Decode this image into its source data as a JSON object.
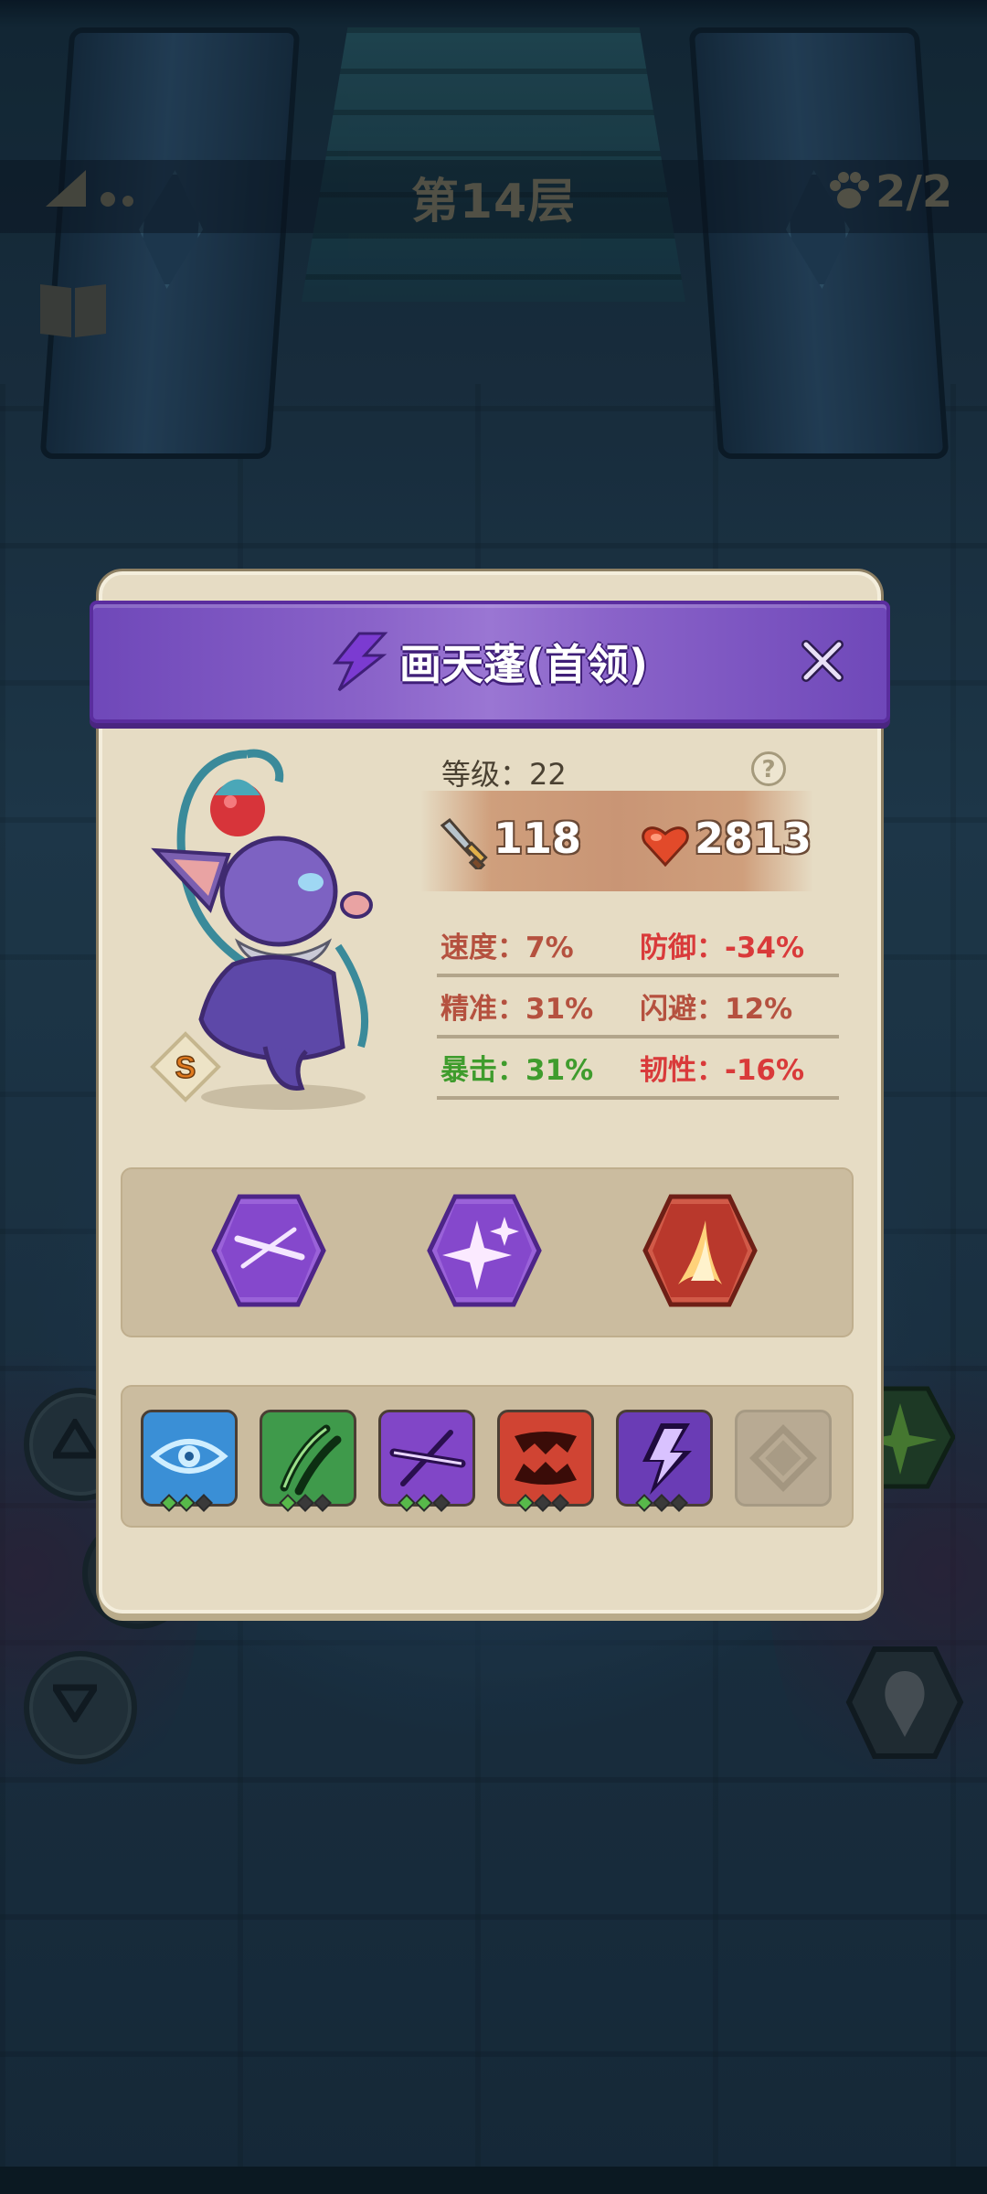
{
  "hud": {
    "floor_title": "第14层",
    "party_count": "2/2"
  },
  "panel": {
    "title": "画天蓬(首领)",
    "rank": "S",
    "level_label": "等级：22",
    "help_symbol": "?",
    "attack": "118",
    "health": "2813",
    "attributes": [
      {
        "left": "速度：7%",
        "left_color": "#b5513f",
        "right": "防御：-34%",
        "right_color": "#d93a3a"
      },
      {
        "left": "精准：31%",
        "left_color": "#b5513f",
        "right": "闪避：12%",
        "right_color": "#b5513f"
      },
      {
        "left": "暴击：31%",
        "left_color": "#3f9c2d",
        "right": "韧性：-16%",
        "right_color": "#d93a3a"
      }
    ],
    "skills": [
      {
        "icon": "slash-skill-icon",
        "color": "#8b4fd0"
      },
      {
        "icon": "sparkle-skill-icon",
        "color": "#8b4fd0"
      },
      {
        "icon": "flame-claw-skill-icon",
        "color": "#c2473a"
      }
    ],
    "equipment": [
      {
        "icon": "eye-icon",
        "color": "#3a8fd6",
        "pips": [
          "#57b94a",
          "#57b94a",
          "#3a3a3a"
        ]
      },
      {
        "icon": "claw-scratch-icon",
        "color": "#3f9a4b",
        "pips": [
          "#57b94a",
          "#3a3a3a",
          "#3a3a3a"
        ]
      },
      {
        "icon": "slash-icon",
        "color": "#8146c7",
        "pips": [
          "#57b94a",
          "#57b94a",
          "#3a3a3a"
        ]
      },
      {
        "icon": "fangs-icon",
        "color": "#d04433",
        "pips": [
          "#57b94a",
          "#3a3a3a",
          "#3a3a3a"
        ]
      },
      {
        "icon": "lightning-icon",
        "color": "#6a3cb5",
        "pips": [
          "#57b94a",
          "#3a3a3a",
          "#3a3a3a"
        ]
      },
      {
        "icon": "empty-slot-icon",
        "color": "#b8aa93",
        "pips": []
      }
    ]
  }
}
